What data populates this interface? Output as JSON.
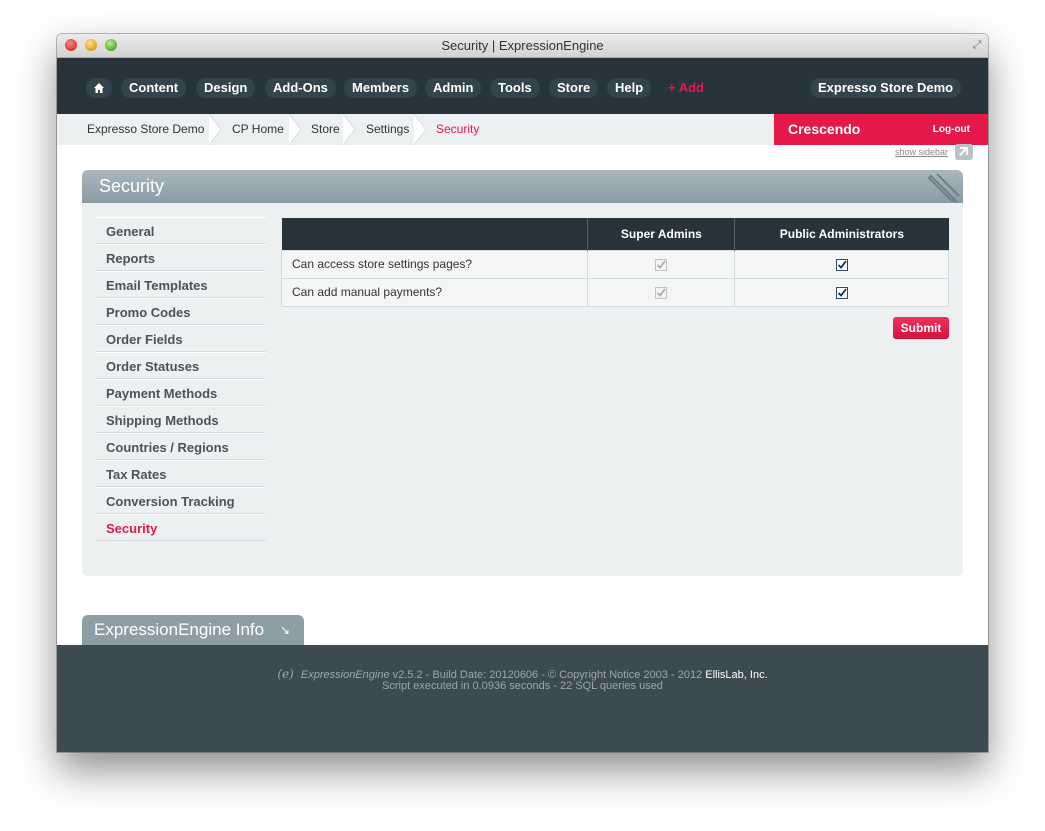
{
  "window": {
    "title": "Security | ExpressionEngine"
  },
  "topnav": {
    "items": [
      "Content",
      "Design",
      "Add-Ons",
      "Members",
      "Admin",
      "Tools",
      "Store",
      "Help"
    ],
    "add_label": "+ Add",
    "site_label": "Expresso Store Demo"
  },
  "breadcrumb": {
    "items": [
      "Expresso Store Demo",
      "CP Home",
      "Store",
      "Settings"
    ],
    "current": "Security"
  },
  "user": {
    "name": "Crescendo",
    "logout": "Log-out"
  },
  "show_sidebar": "show sidebar",
  "panel": {
    "title": "Security"
  },
  "leftnav": {
    "items": [
      "General",
      "Reports",
      "Email Templates",
      "Promo Codes",
      "Order Fields",
      "Order Statuses",
      "Payment Methods",
      "Shipping Methods",
      "Countries / Regions",
      "Tax Rates",
      "Conversion Tracking",
      "Security"
    ],
    "active": "Security"
  },
  "permissions": {
    "columns": [
      "",
      "Super Admins",
      "Public Administrators"
    ],
    "rows": [
      {
        "label": "Can access store settings pages?",
        "super_admins": true,
        "public_admins": true
      },
      {
        "label": "Can add manual payments?",
        "super_admins": true,
        "public_admins": true
      }
    ]
  },
  "submit_label": "Submit",
  "info_tab": {
    "label": "ExpressionEngine Info"
  },
  "footer": {
    "product": "ExpressionEngine",
    "line1": "v2.5.2 - Build Date: 20120606 - © Copyright Notice 2003 - 2012",
    "company": "EllisLab, Inc.",
    "line2": "Script executed in 0.0936 seconds - 22 SQL queries used"
  },
  "colors": {
    "accent": "#e4194a",
    "nav_bg": "#27343b",
    "footer_bg": "#3c4a51"
  }
}
